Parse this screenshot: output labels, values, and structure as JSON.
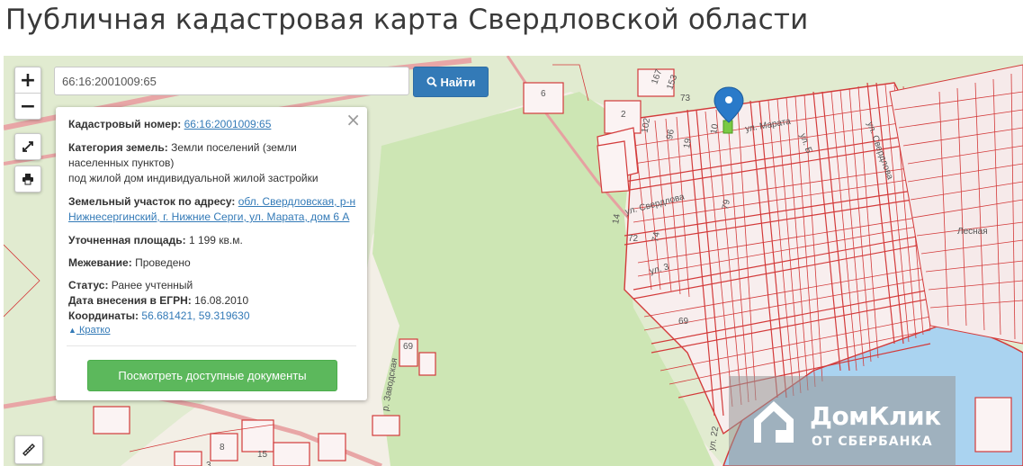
{
  "page": {
    "title": "Публичная кадастровая карта Свердловской области"
  },
  "search": {
    "value": "66:16:2001009:65",
    "button_label": "Найти",
    "button_icon": "search-icon"
  },
  "map_controls": {
    "zoom_in": "+",
    "zoom_out": "−",
    "fullscreen_icon": "expand-icon",
    "print_icon": "printer-icon",
    "ruler_icon": "ruler-icon"
  },
  "popup": {
    "cadastral_label": "Кадастровый номер:",
    "cadastral_value": "66:16:2001009:65",
    "category_label": "Категория земель:",
    "category_line1": "Земли поселений (земли",
    "category_line2": "населенных пунктов)",
    "category_line3": "под жилой дом индивидуальной жилой застройки",
    "address_label": "Земельный участок по адресу:",
    "address_line1": "обл. Свердловская, р-н",
    "address_line2": "Нижнесергинский, г. Нижние Серги, ул. Марата, дом 6 А",
    "area_label": "Уточненная площадь:",
    "area_value": "1 199 кв.м.",
    "survey_label": "Межевание:",
    "survey_value": "Проведено",
    "status_label": "Статус:",
    "status_value": "Ранее учтенный",
    "date_label": "Дата внесения в ЕГРН:",
    "date_value": "16.08.2010",
    "coords_label": "Координаты:",
    "coords_value": "56.681421, 59.319630",
    "collapse_link": "Кратко",
    "docs_button": "Посмотреть доступные документы",
    "close": "×"
  },
  "map_labels": {
    "plot_6": "6",
    "plot_2": "2",
    "plot_167": "167",
    "plot_153": "153",
    "plot_73": "73",
    "plot_102": "102",
    "plot_96": "96",
    "plot_10": "10",
    "plot_19": "19",
    "plot_14": "14",
    "plot_72": "72",
    "plot_74": "74",
    "plot_79": "79",
    "plot_69a": "69",
    "plot_69b": "69",
    "plot_8": "8",
    "plot_15": "15",
    "plot_3": "3",
    "street_marata": "ул. Марата",
    "street_sverdlova": "ул. Свердлова",
    "street_rzavod": "р. Заводская",
    "street_22": "ул. 22",
    "street_b": "ул. Б",
    "street_sverdlova2": "ул. Свердлова",
    "street_lesnaya": "Лесная",
    "street_3": "ул. 3"
  },
  "watermark": {
    "brand": "ДомКлик",
    "subtitle": "ОТ СБЕРБАНКА"
  },
  "colors": {
    "plot_line": "#d33a3a",
    "forest": "#cfe6b8",
    "water": "#aad3f0",
    "primary": "#337ab7",
    "success": "#5cb85c",
    "marker": "#2a7ac9"
  }
}
